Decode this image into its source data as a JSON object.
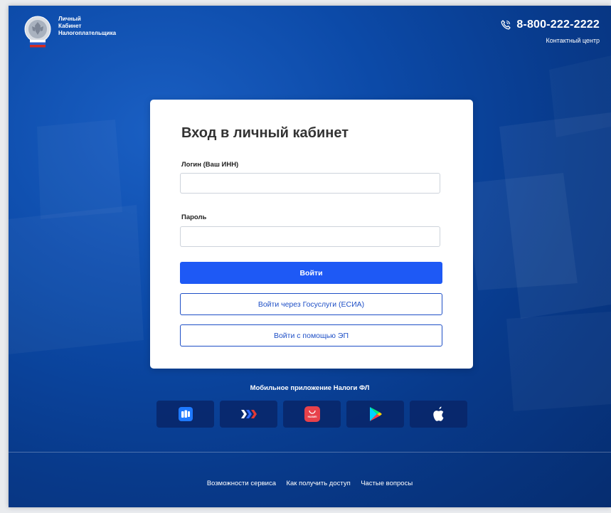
{
  "header": {
    "logo_lines": [
      "Личный",
      "Кабинет",
      "Налогоплательщика"
    ],
    "phone": "8-800-222-2222",
    "phone_caption": "Контактный центр",
    "phone_icon": "phone-icon"
  },
  "login": {
    "title": "Вход в личный кабинет",
    "login_label": "Логин (Ваш ИНН)",
    "login_value": "",
    "login_placeholder": "",
    "password_label": "Пароль",
    "password_value": "",
    "password_placeholder": "",
    "submit_label": "Войти",
    "gosuslugi_label": "Войти через Госуслуги (ЕСИА)",
    "ep_label": "Войти с помощью ЭП"
  },
  "mobile": {
    "title": "Мобильное приложение Налоги ФЛ",
    "stores": [
      {
        "icon": "rustore-icon"
      },
      {
        "icon": "nashstore-icon"
      },
      {
        "icon": "huawei-appgallery-icon",
        "text": "HUAWEI"
      },
      {
        "icon": "google-play-icon"
      },
      {
        "icon": "apple-icon"
      }
    ]
  },
  "footer": {
    "links": [
      "Возможности сервиса",
      "Как получить доступ",
      "Частые вопросы"
    ]
  },
  "colors": {
    "primary_button": "#1e59f5",
    "outline_button": "#1e4fc6",
    "background": "#0c4aa8"
  }
}
